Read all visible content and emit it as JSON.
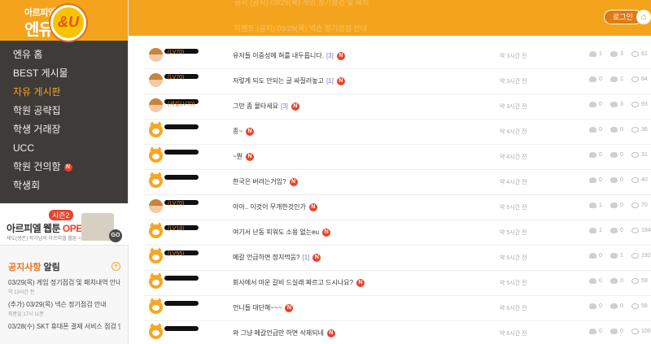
{
  "logo": {
    "small": "아르피엘",
    "big": "엔유",
    "mark": "&U"
  },
  "nav": [
    {
      "label": "엔유 홈",
      "active": false,
      "new": false
    },
    {
      "label": "BEST 게시물",
      "active": false,
      "new": false
    },
    {
      "label": "자유 게시판",
      "active": true,
      "new": false
    },
    {
      "label": "학원 공략집",
      "active": false,
      "new": false
    },
    {
      "label": "학생 거래장",
      "active": false,
      "new": false
    },
    {
      "label": "UCC",
      "active": false,
      "new": false
    },
    {
      "label": "학원 건의함",
      "active": false,
      "new": true
    },
    {
      "label": "학생회",
      "active": false,
      "new": false
    }
  ],
  "new_badge": "N",
  "banner": {
    "title": "아르피엘 웹툰",
    "open": "OPEN",
    "season": "시즌2",
    "sub": "세도(생존) 작가님의 아르피엘 웹툰 시즌2",
    "go": "GO"
  },
  "notice": {
    "title_orange": "공지사항",
    "title_rest": " 알림",
    "more": "+",
    "items": [
      {
        "text": "03/29(목) 게임 정기점검 및 패치내역 안내",
        "time": "약 13시간 전"
      },
      {
        "text": "(추가) 03/29(목) 넥슨 정기점검 안내",
        "time": "최종일 17시 11분"
      },
      {
        "text": "03/28(수) SKT 휴대폰 결제 서비스 점검 안",
        "time": ""
      }
    ]
  },
  "topbar": {
    "ghost1": "공지 (공지) 03/29(목) 게임 정기점검 및 패치",
    "ghost2": "이벤트 (공지) 03/29(목) 넥슨 정기점검 안내",
    "login": "로그인",
    "home_icon": "house-icon"
  },
  "posts": [
    {
      "avatar": "photo",
      "writer": "(LV70)",
      "title": "유저들 이중성에 혀를 내두릅니다.",
      "comments": "[3]",
      "new": true,
      "time": "약 3시간 전",
      "likes": "1",
      "replies": "3",
      "views": "61"
    },
    {
      "avatar": "photo",
      "writer": "(LV70)",
      "title": "저렇게 되도 안되는 글 싸질러놓고",
      "comments": "[1]",
      "new": true,
      "time": "약 3시간 전",
      "likes": "0",
      "replies": "1",
      "views": "84"
    },
    {
      "avatar": "photo",
      "writer": "(세실LV70)",
      "title": "그만 좀 물타세요",
      "comments": "[3]",
      "new": true,
      "time": "약 3시간 전",
      "likes": "0",
      "replies": "3",
      "views": "93"
    },
    {
      "avatar": "cat",
      "writer": "",
      "title": "종~",
      "comments": "",
      "new": true,
      "time": "약 4시간 전",
      "likes": "0",
      "replies": "0",
      "views": "36"
    },
    {
      "avatar": "cat",
      "writer": "",
      "title": "~뭔",
      "comments": "",
      "new": true,
      "time": "약 4시간 전",
      "likes": "0",
      "replies": "0",
      "views": "31"
    },
    {
      "avatar": "cat",
      "writer": "",
      "title": "한국은 버려는거임?",
      "comments": "",
      "new": true,
      "time": "약 4시간 전",
      "likes": "0",
      "replies": "0",
      "views": "40"
    },
    {
      "avatar": "photo",
      "writer": "(LV70)",
      "title": "아아.. 이것이 무개한것인가",
      "comments": "",
      "new": true,
      "time": "약 5시간 전",
      "likes": "1",
      "replies": "0",
      "views": "70"
    },
    {
      "avatar": "cat",
      "writer": "(LV18)",
      "title": "여기서 난동 피워도 소용 없는eu",
      "comments": "",
      "new": true,
      "time": "약 5시간 전",
      "likes": "1",
      "replies": "0",
      "views": "184"
    },
    {
      "avatar": "cat",
      "writer": "(LV55)",
      "title": "메갈 언급하면 정지먹음?",
      "comments": "[1]",
      "new": true,
      "time": "약 5시간 전",
      "likes": "0",
      "replies": "1",
      "views": "192"
    },
    {
      "avatar": "cat",
      "writer": "",
      "title": "회사에서 마운 갈비 드실래 짜르고 드시나요?",
      "comments": "",
      "new": true,
      "time": "약 5시간 전",
      "likes": "0",
      "replies": "0",
      "views": "59"
    },
    {
      "avatar": "cat",
      "writer": "",
      "title": "언니들 대단해~~~",
      "comments": "",
      "new": true,
      "time": "약 6시간 전",
      "likes": "0",
      "replies": "0",
      "views": "58"
    },
    {
      "avatar": "cat",
      "writer": "",
      "title": "와 그냥 메갈언급만 하면 삭제되네",
      "comments": "",
      "new": true,
      "time": "약 6시간 전",
      "likes": "0",
      "replies": "0",
      "views": "100"
    }
  ]
}
